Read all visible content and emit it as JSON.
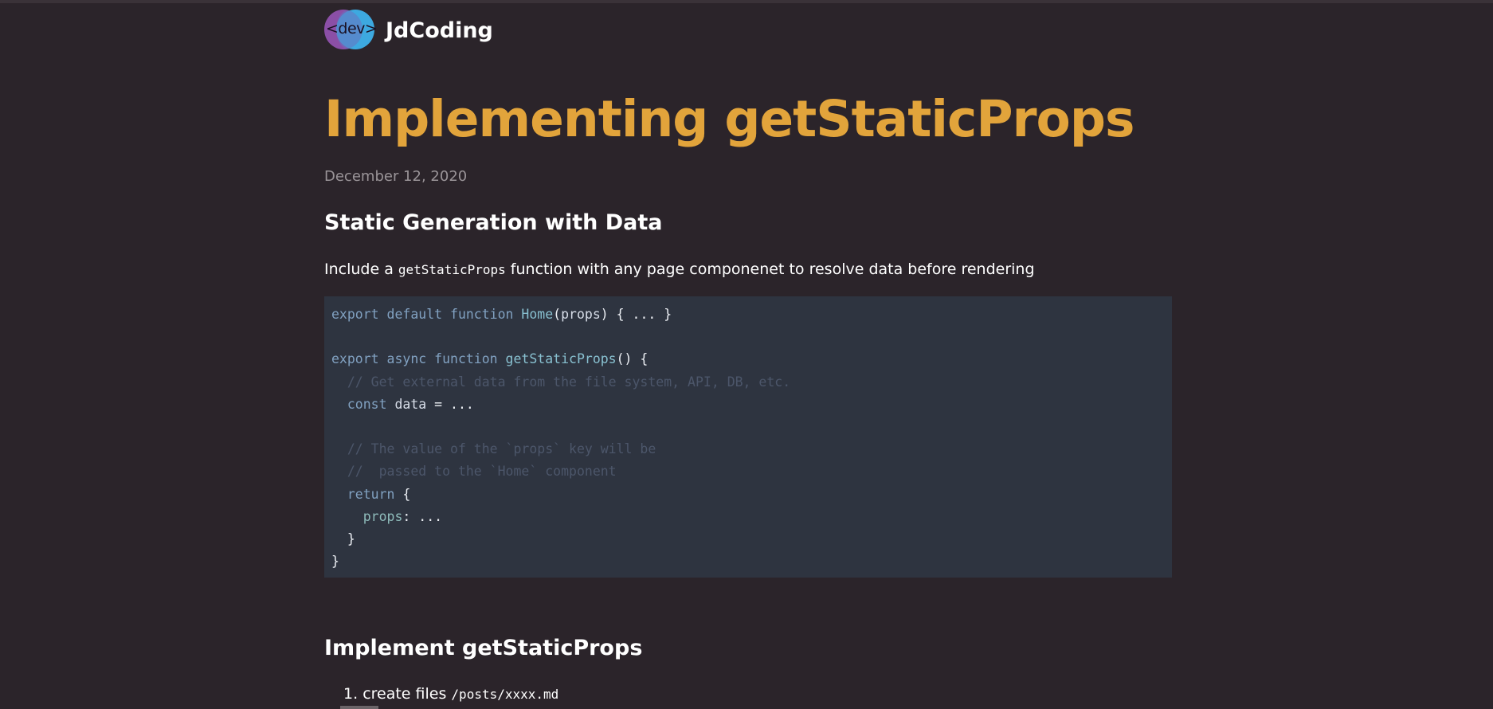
{
  "site": {
    "logo_text": "<dev>",
    "name": "JdCoding"
  },
  "post": {
    "title": "Implementing getStaticProps",
    "date": "December 12, 2020"
  },
  "section1": {
    "heading": "Static Generation with Data",
    "intro_before": "Include a ",
    "intro_code": "getStaticProps",
    "intro_after": " function with any page componenet to resolve data before rendering"
  },
  "code": {
    "lines": [
      [
        [
          "k",
          "export default function "
        ],
        [
          "f",
          "Home"
        ],
        [
          "p",
          "("
        ],
        [
          "t",
          "props"
        ],
        [
          "p",
          ") { ... }"
        ]
      ],
      [],
      [
        [
          "k",
          "export async function "
        ],
        [
          "f",
          "getStaticProps"
        ],
        [
          "p",
          "() {"
        ]
      ],
      [
        [
          "cm",
          "  // Get external data from the file system, API, DB, etc."
        ]
      ],
      [
        [
          "k",
          "  const "
        ],
        [
          "t",
          "data"
        ],
        [
          "p",
          " = ..."
        ]
      ],
      [],
      [
        [
          "cm",
          "  // The value of the `props` key will be"
        ]
      ],
      [
        [
          "cm",
          "  //  passed to the `Home` component"
        ]
      ],
      [
        [
          "k",
          "  return "
        ],
        [
          "p",
          "{"
        ]
      ],
      [
        [
          "pr",
          "    props"
        ],
        [
          "p",
          ": ..."
        ]
      ],
      [
        [
          "p",
          "  }"
        ]
      ],
      [
        [
          "p",
          "}"
        ]
      ]
    ]
  },
  "section2": {
    "heading": "Implement getStaticProps",
    "list": [
      {
        "number": "1.",
        "text": "create files ",
        "code": "/posts/xxxx.md"
      }
    ]
  },
  "colors": {
    "background": "#2b242a",
    "title": "#e2a43b",
    "code_bg": "#2e3440"
  }
}
